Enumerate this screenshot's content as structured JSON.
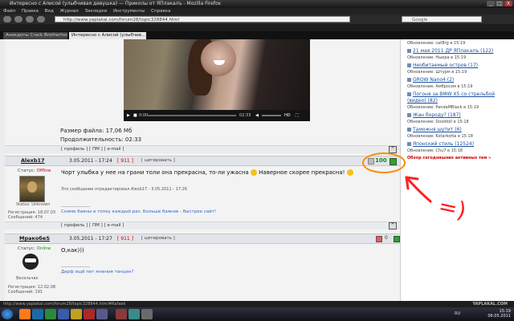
{
  "window": {
    "title": "Интересно с Алисой (улыбчивая девушка) — Приколы от ЯПлакалъ - Mozilla Firefox",
    "min": "_",
    "max": "□",
    "close": "X"
  },
  "menu": [
    "Файл",
    "Правка",
    "Вид",
    "Журнал",
    "Закладки",
    "Инструменты",
    "Справка"
  ],
  "nav": {
    "url": "http://www.yaplakal.com/forum28/topic328844.html",
    "search_placeholder": "Google"
  },
  "tabs": [
    {
      "label": "Анекдоты Crack Brotherhood / Ан..."
    },
    {
      "label": "Интересно с Алисой (улыбчив..."
    }
  ],
  "video": {
    "time_current": "0:00",
    "time_total": "02:33",
    "quality": "HD"
  },
  "file_info": {
    "size": "Размер файла: 17,06 Мб",
    "duration": "Продолжительность: 02:33"
  },
  "posts": [
    {
      "user": "Alexb17",
      "date": "3.05.2011 - 17:24",
      "num": "911",
      "quote": "цитировать",
      "status_label": "Статус:",
      "status": "Offline",
      "avatar_caption": "Status: Unknown",
      "reg": "Регистрация: 18.07.03",
      "msgs": "Сообщений: 474",
      "text": "Чорт улыбка у нее на грани толи она прекрасна, то-ли ужасна",
      "text2": "Наверное скорее прекрасна!",
      "edited": "Это сообщение отредактировал Alexb17 - 3.05.2011 - 17:26",
      "sig": "Сниме баяны в топку каждый раз. Больше баянов - быстрее сайт!",
      "rating": "100"
    },
    {
      "user": "МракобеS",
      "date": "3.05.2011 - 17:27",
      "num": "911",
      "quote": "цитировать",
      "status_label": "Статус:",
      "status": "Online",
      "avatar_caption": "Весельчак",
      "reg": "Регистрация: 12.02.08",
      "msgs": "Сообщений: 191",
      "text": "О,как)))",
      "sig": "Дарф ещё пет мнения танцен?",
      "rating": "0"
    }
  ],
  "post_links": {
    "profile": "профиль",
    "pm": "ПМ",
    "email": "e-mail"
  },
  "sidebar": {
    "items": [
      {
        "title": "",
        "sub": "Обновление: catBrg в 15:19"
      },
      {
        "title": "21 мая 2011 ДР ЯПлакалъ (122)",
        "sub": "Обновление: Ньюра в 15:19"
      },
      {
        "title": "Необитаемый остров (17)",
        "sub": "Обновление: Штурм в 15:19"
      },
      {
        "title": "GROW Nano4 (2)",
        "sub": "Обновление: Амбросия в 15:19"
      },
      {
        "title": "Погоня за BMW X5 со стрельбой (видео) (82)",
        "sub": "Обновление: PandaMBlack в 15:19"
      },
      {
        "title": "Жан бороду? (187)",
        "sub": "Обновление: Doodlo0 в 15:18"
      },
      {
        "title": "Таможня шутит (6)",
        "sub": "Обновление: Kotarkotta в 15:18"
      },
      {
        "title": "Японский стиль (12524)",
        "sub": "Обновление: Chu7 в 15:18"
      }
    ],
    "overview": "Обзор сегодняшних активных тем »"
  },
  "status": {
    "url": "http://www.yaplakal.com/forum28/topic328844.html#Rafaek"
  },
  "taskbar": {
    "lang": "RU",
    "time": "15:19",
    "date": "06.05.2011",
    "watermark": "YAPLAKAL.COM"
  },
  "annotation": {
    "text": "=)"
  },
  "colors": {
    "annotation": "#ff8a00",
    "arrow": "#ff2020",
    "offline": "#d00000",
    "online": "#009900"
  }
}
